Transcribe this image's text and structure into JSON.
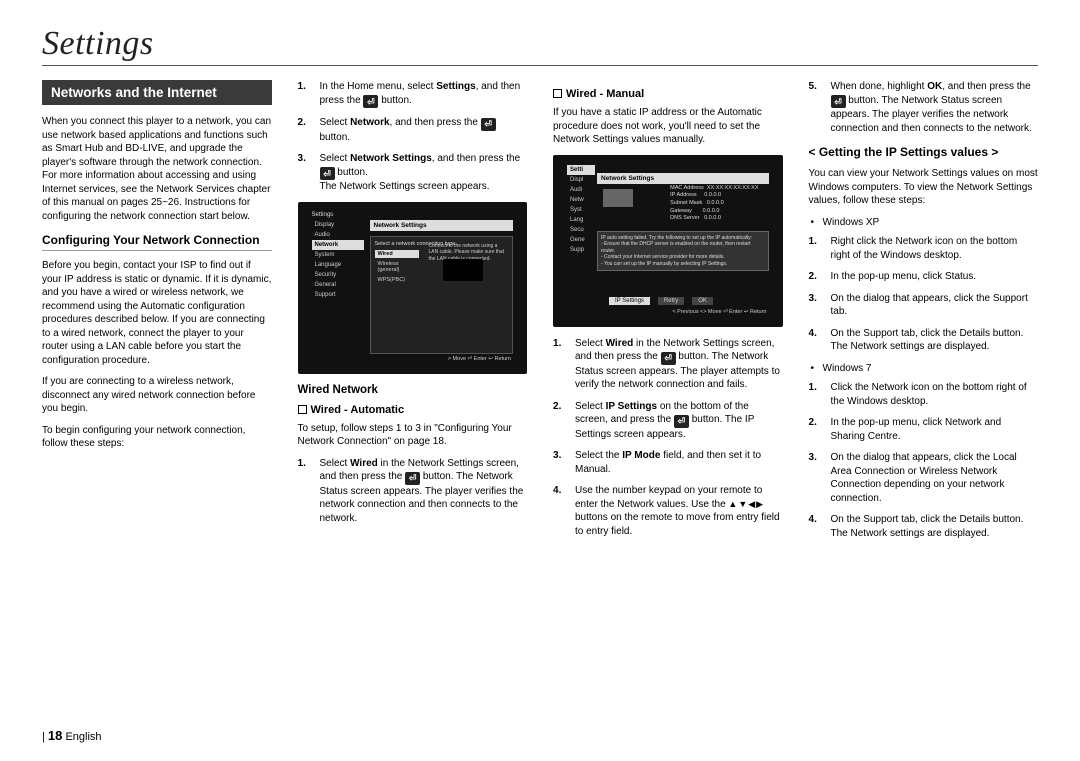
{
  "page_title": "Settings",
  "banner": "Networks and the Internet",
  "intro": "When you connect this player to a network, you can use network based applications and functions such as Smart Hub and BD-LIVE, and upgrade the player's software through the network connection. For more information about accessing and using Internet services, see the Network Services chapter of this manual on pages 25~26. Instructions for configuring the network connection start below.",
  "sub_config": "Configuring Your Network Connection",
  "config_p1": "Before you begin, contact your ISP to find out if your IP address is static or dynamic. If it is dynamic, and you have a wired or wireless network, we recommend using the Automatic configuration procedures described below. If you are connecting to a wired network, connect the player to your router using a LAN cable before you start the configuration procedure.",
  "config_p2": "If you are connecting to a wireless network, disconnect any wired network connection before you begin.",
  "config_p3": "To begin configuring your network connection, follow these steps:",
  "col2": {
    "li1a": "In the Home menu, select ",
    "li1b": "Settings",
    "li1c": ", and then press the ",
    "li1d": " button.",
    "li2a": "Select ",
    "li2b": "Network",
    "li2c": ", and then press the ",
    "li2d": " button.",
    "li3a": "Select ",
    "li3b": "Network Settings",
    "li3c": ", and then press the ",
    "li3d": " button.",
    "li3e": "The Network Settings screen appears.",
    "wired_head": "Wired Network",
    "auto_head": "Wired - Automatic",
    "auto_p": "To setup, follow steps 1 to 3 in \"Configuring Your Network Connection\" on page 18.",
    "auto_li1a": "Select ",
    "auto_li1b": "Wired",
    "auto_li1c": " in the Network Settings screen, and then press the ",
    "auto_li1d": " button. The Network Status screen appears. The player verifies the network connection and then connects to the network."
  },
  "shot1": {
    "title": "Settings",
    "tab": "Network Settings",
    "sub": "Select a network connection type.",
    "side": [
      "Display",
      "Audio",
      "Network",
      "System",
      "Language",
      "Security",
      "General",
      "Support"
    ],
    "chips": [
      "Wired",
      "Wireless (general)",
      "WPS(PBC)"
    ],
    "maintext": "Connect to the network using a LAN cable. Please make sure that the LAN cable is connected.",
    "foot": "> Move   ⏎ Enter   ↩ Return"
  },
  "col3": {
    "manual_head": "Wired - Manual",
    "manual_p": "If you have a static IP address or the Automatic procedure does not work, you'll need to set the Network Settings values manually.",
    "m1a": "Select ",
    "m1b": "Wired",
    "m1c": " in the Network Settings screen, and then press the ",
    "m1d": " button. The Network Status screen appears. The player attempts to verify the network connection and fails.",
    "m2a": "Select ",
    "m2b": "IP Settings",
    "m2c": " on the bottom of the screen, and press the ",
    "m2d": " button. The IP Settings screen appears.",
    "m3a": "Select the ",
    "m3b": "IP Mode",
    "m3c": " field, and then set it to Manual.",
    "m4a": "Use the number keypad on your remote to enter the Network values. Use the ",
    "m4b": " buttons on the remote to move from entry field to entry field."
  },
  "shot2": {
    "tab": "Network Settings",
    "side": [
      "Setti",
      "Displ",
      "Audi",
      "Netw",
      "Syst",
      "Lang",
      "Secu",
      "Gene",
      "Supp"
    ],
    "info_labels": [
      "MAC Address",
      "IP Address",
      "Subnet Mask",
      "Gateway",
      "DNS Server"
    ],
    "info_vals": [
      "XX:XX:XX:XX:XX:XX",
      "0.0.0.0",
      "0.0.0.0",
      "0.0.0.0",
      "0.0.0.0"
    ],
    "msg": "IP auto setting failed. Try the following to set up the IP automatically:\n- Ensure that the DHCP server is enabled on the router, then restart router.\n- Contact your Internet service provider for more details.\n- You can set up the IP manually by selecting IP Settings.",
    "btns": [
      "IP Settings",
      "Retry",
      "OK"
    ],
    "foot": "< Previous   <> Move   ⏎ Enter   ↩ Return"
  },
  "col4": {
    "li5a": "When done, highlight ",
    "li5b": "OK",
    "li5c": ", and then press the ",
    "li5d": " button. The Network Status screen appears. The player verifies the network connection and then connects to the network.",
    "gethead": "< Getting the IP Settings values >",
    "getp": "You can view your Network Settings values on most Windows computers. To view the Network Settings values, follow these steps:",
    "xp": "Windows XP",
    "xp1": "Right click the Network icon on the bottom right of the Windows desktop.",
    "xp2": "In the pop-up menu, click Status.",
    "xp3": "On the dialog that appears, click the Support tab.",
    "xp4": "On the Support tab, click the Details button.",
    "xp4b": "The Network settings are displayed.",
    "w7": "Windows 7",
    "w71": "Click the Network icon on the bottom right of the Windows desktop.",
    "w72": "In the pop-up menu, click Network and Sharing Centre.",
    "w73": "On the dialog that appears, click the Local Area Connection or Wireless Network Connection depending on your network connection.",
    "w74": "On the Support tab, click the Details button.",
    "w74b": "The Network settings are displayed."
  },
  "footer": {
    "page": "18",
    "lang": "English"
  }
}
